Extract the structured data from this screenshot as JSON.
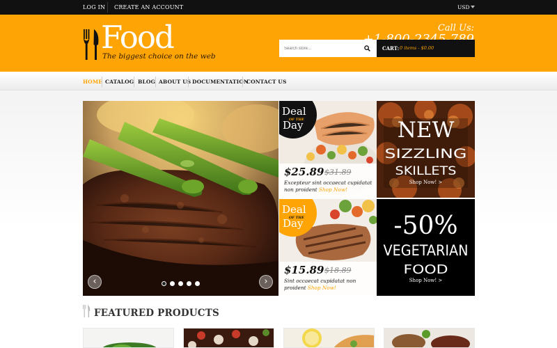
{
  "topbar": {
    "login": "LOG IN",
    "create_account": "CREATE AN ACCOUNT",
    "currency": "USD"
  },
  "header": {
    "logo_text": "Food",
    "tagline": "The biggest choice on the web",
    "call_label": "Call Us:",
    "phone": "+1-800-2345-789",
    "search_placeholder": "Search store...",
    "cart_label": "CART:",
    "cart_value": "0 items - $0.00"
  },
  "nav": {
    "items": [
      {
        "label": "HOME",
        "active": true
      },
      {
        "label": "CATALOG"
      },
      {
        "label": "BLOG"
      },
      {
        "label": "ABOUT US"
      },
      {
        "label": "DOCUMENTATION"
      },
      {
        "label": "CONTACT US"
      }
    ]
  },
  "slider": {
    "prev_icon": "chevron-left-icon",
    "next_icon": "chevron-right-icon",
    "dot_count": 5,
    "active_dot": 0
  },
  "deals": [
    {
      "badge_line1": "Deal",
      "badge_line2": "OF THE",
      "badge_line3": "Day",
      "price": "$25.89",
      "old_price": "$31.89",
      "desc": "Excepteur sint occaecat cupidatat non proident",
      "link": "Shop Now!"
    },
    {
      "badge_line1": "Deal",
      "badge_line2": "OF THE",
      "badge_line3": "Day",
      "price": "$15.89",
      "old_price": "$18.89",
      "desc": "Sint occaecat cupidatat non proident",
      "link": "Shop Now!"
    }
  ],
  "promos": [
    {
      "line1": "NEW",
      "line2": "SIZZLING",
      "line3": "SKILLETS",
      "link": "Shop Now! >"
    },
    {
      "line1": "-50%",
      "line2": "VEGETARIAN",
      "line3": "FOOD",
      "link": "Shop Now! >"
    }
  ],
  "featured": {
    "title": "FEATURED PRODUCTS"
  },
  "colors": {
    "accent": "#fea404",
    "dark": "#111111"
  }
}
